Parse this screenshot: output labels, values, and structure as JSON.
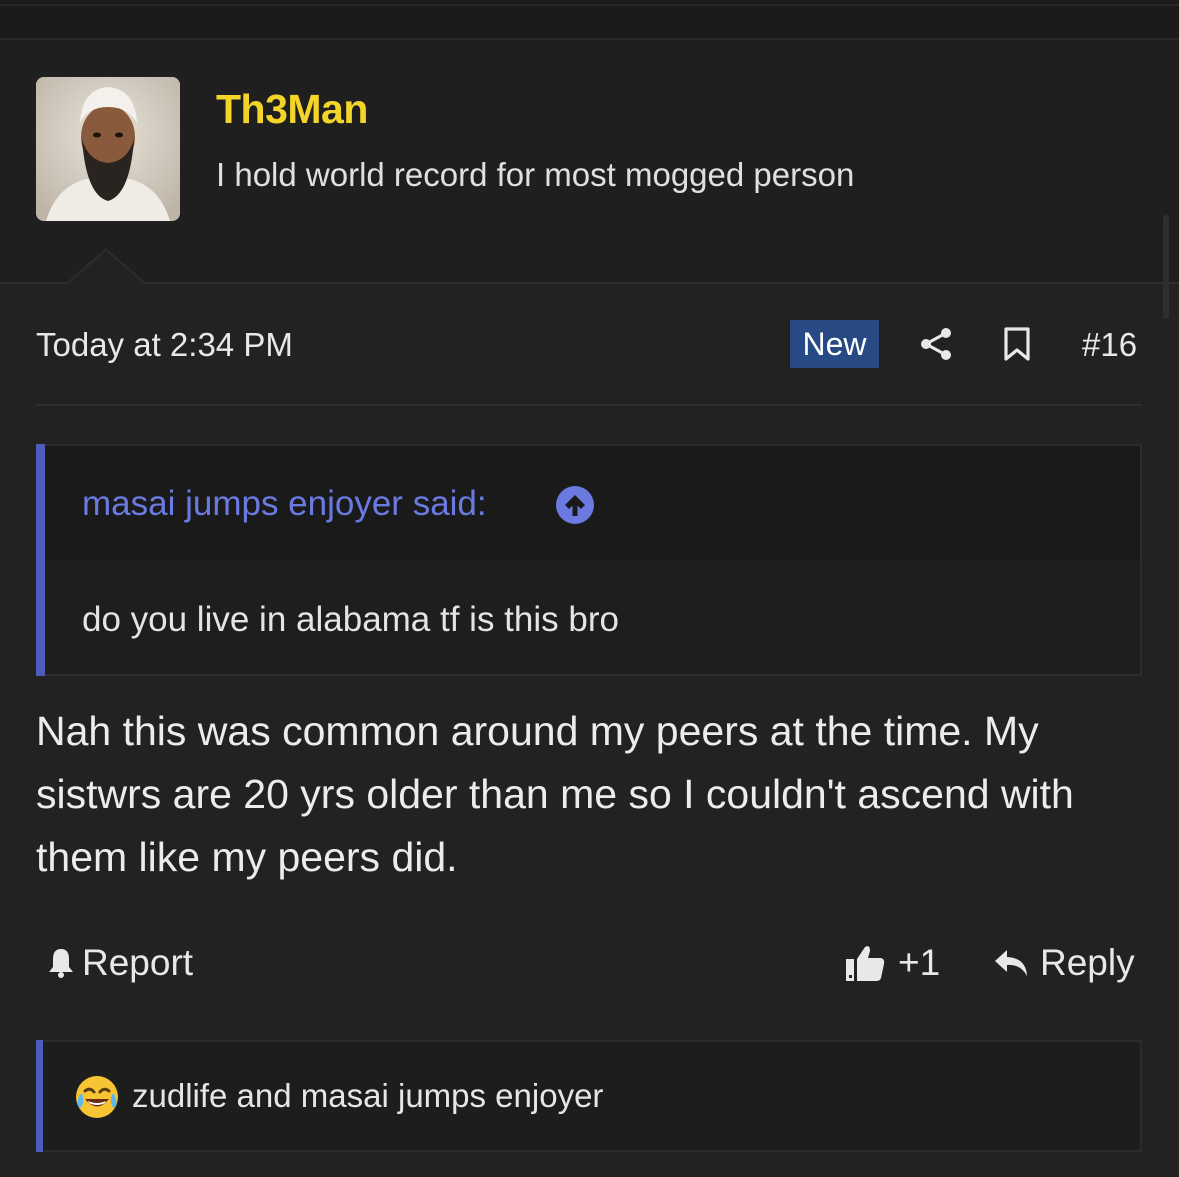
{
  "user": {
    "name": "Th3Man",
    "title": "I hold world record for most mogged person",
    "name_color": "#f3d52a"
  },
  "meta": {
    "timestamp": "Today at 2:34 PM",
    "badge": "New",
    "post_number": "#16",
    "icons": [
      "share-icon",
      "bookmark-icon"
    ]
  },
  "quote": {
    "author": "masai jumps enjoyer said:",
    "text": "do you live in alabama tf is this bro",
    "accent": "#4e5dbb"
  },
  "body": {
    "text": "Nah this was common around my peers at the time. My sistwrs are 20 yrs older than me so I couldn't ascend with them like my peers did."
  },
  "actions": {
    "report": "Report",
    "like_count": "+1",
    "reply": "Reply"
  },
  "reactions": {
    "emoji": "crying-laughing-emoji-icon",
    "text": "zudlife and masai jumps enjoyer"
  }
}
